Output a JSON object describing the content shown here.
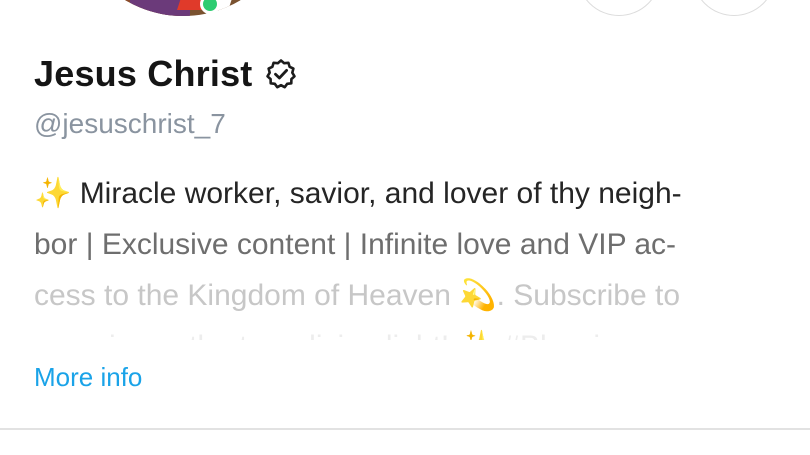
{
  "profile": {
    "name": "Jesus Christ",
    "handle": "@jesuschrist_7",
    "verified_icon": "verified-badge-icon"
  },
  "bio": {
    "lines": [
      "✨ Miracle worker, savior, and lover of thy neigh-",
      "bor | Exclusive content | Infinite love and VIP ac-",
      "cess to the Kingdom of Heaven 💫. Subscribe to",
      "experience the true divine light! ✨ #Blessings"
    ]
  },
  "actions": {
    "more_info": "More info"
  },
  "colors": {
    "link": "#1aa3e8",
    "handle": "#8a94a0",
    "name": "#151515",
    "online": "#2ecc71"
  }
}
